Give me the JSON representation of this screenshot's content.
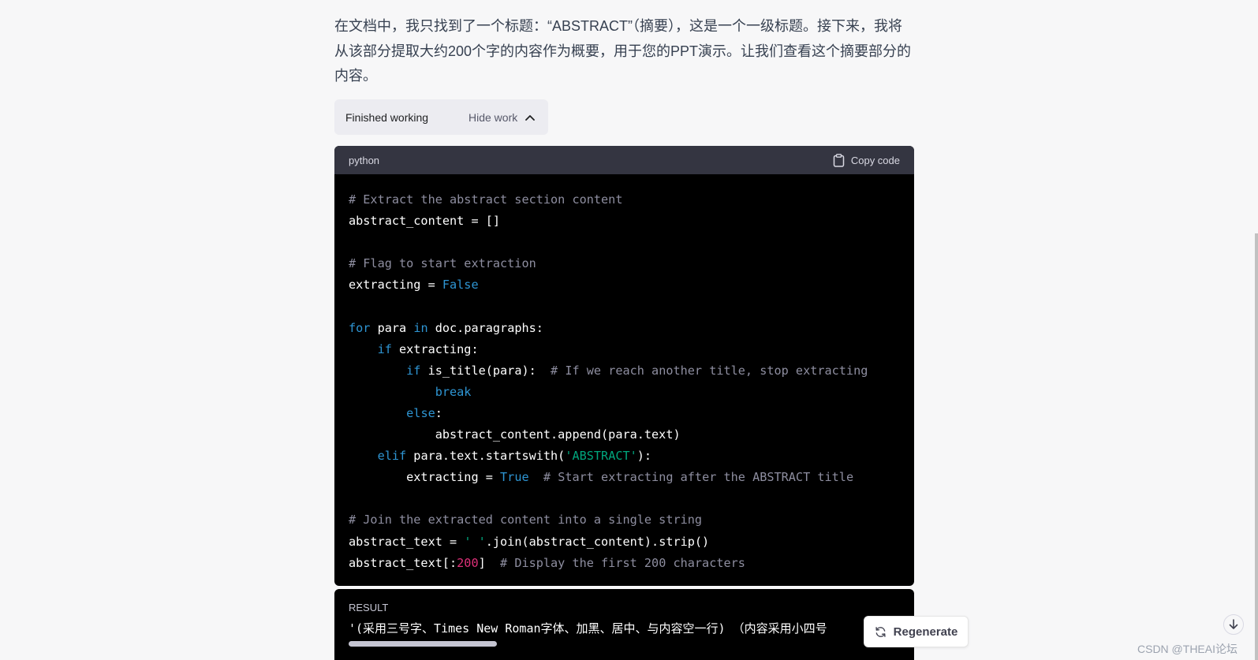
{
  "message": {
    "text": "在文档中，我只找到了一个标题：“ABSTRACT”（摘要），这是一个一级标题。接下来，我将从该部分提取大约200个字的内容作为概要，用于您的PPT演示。让我们查看这个摘要部分的内容。"
  },
  "work_toggle": {
    "status": "Finished working",
    "hide_label": "Hide work"
  },
  "code_block": {
    "language": "python",
    "copy_label": "Copy code",
    "lines": [
      [
        {
          "t": "# Extract the abstract section content",
          "c": "cm"
        }
      ],
      [
        {
          "t": "abstract_content = []",
          "c": ""
        }
      ],
      [],
      [
        {
          "t": "# Flag to start extraction",
          "c": "cm"
        }
      ],
      [
        {
          "t": "extracting = ",
          "c": ""
        },
        {
          "t": "False",
          "c": "kw"
        }
      ],
      [],
      [
        {
          "t": "for",
          "c": "kw"
        },
        {
          "t": " para ",
          "c": ""
        },
        {
          "t": "in",
          "c": "kw"
        },
        {
          "t": " doc.paragraphs:",
          "c": ""
        }
      ],
      [
        {
          "t": "    ",
          "c": ""
        },
        {
          "t": "if",
          "c": "kw"
        },
        {
          "t": " extracting:",
          "c": ""
        }
      ],
      [
        {
          "t": "        ",
          "c": ""
        },
        {
          "t": "if",
          "c": "kw"
        },
        {
          "t": " is_title(para):  ",
          "c": ""
        },
        {
          "t": "# If we reach another title, stop extracting",
          "c": "cm"
        }
      ],
      [
        {
          "t": "            ",
          "c": ""
        },
        {
          "t": "break",
          "c": "kw"
        }
      ],
      [
        {
          "t": "        ",
          "c": ""
        },
        {
          "t": "else",
          "c": "kw"
        },
        {
          "t": ":",
          "c": ""
        }
      ],
      [
        {
          "t": "            abstract_content.append(para.text)",
          "c": ""
        }
      ],
      [
        {
          "t": "    ",
          "c": ""
        },
        {
          "t": "elif",
          "c": "kw"
        },
        {
          "t": " para.text.startswith(",
          "c": ""
        },
        {
          "t": "'ABSTRACT'",
          "c": "st"
        },
        {
          "t": "):",
          "c": ""
        }
      ],
      [
        {
          "t": "        extracting = ",
          "c": ""
        },
        {
          "t": "True",
          "c": "kw"
        },
        {
          "t": "  ",
          "c": ""
        },
        {
          "t": "# Start extracting after the ABSTRACT title",
          "c": "cm"
        }
      ],
      [],
      [
        {
          "t": "# Join the extracted content into a single string",
          "c": "cm"
        }
      ],
      [
        {
          "t": "abstract_text = ",
          "c": ""
        },
        {
          "t": "' '",
          "c": "st"
        },
        {
          "t": ".join(abstract_content).strip()",
          "c": ""
        }
      ],
      [
        {
          "t": "abstract_text[:",
          "c": ""
        },
        {
          "t": "200",
          "c": "nm"
        },
        {
          "t": "]  ",
          "c": ""
        },
        {
          "t": "# Display the first 200 characters",
          "c": "cm"
        }
      ]
    ]
  },
  "result": {
    "label": "RESULT",
    "text": "'(采用三号字、Times New Roman字体、加黑、居中、与内容空一行) （内容采用小四号",
    "scroll_position": 0.0
  },
  "regenerate": {
    "label": "Regenerate"
  },
  "watermark": {
    "text": "CSDN @THEAI论坛"
  },
  "colors": {
    "background": "#f7f7f8",
    "code_bg": "#000000",
    "code_header_bg": "#343541",
    "keyword": "#2e95d3",
    "comment": "#8e8ea0",
    "string": "#00a67d",
    "number": "#df3079"
  },
  "icons": {
    "hide_work": "chevron-up-icon",
    "copy": "clipboard-icon",
    "regenerate": "refresh-icon",
    "scroll_down": "arrow-down-icon"
  }
}
